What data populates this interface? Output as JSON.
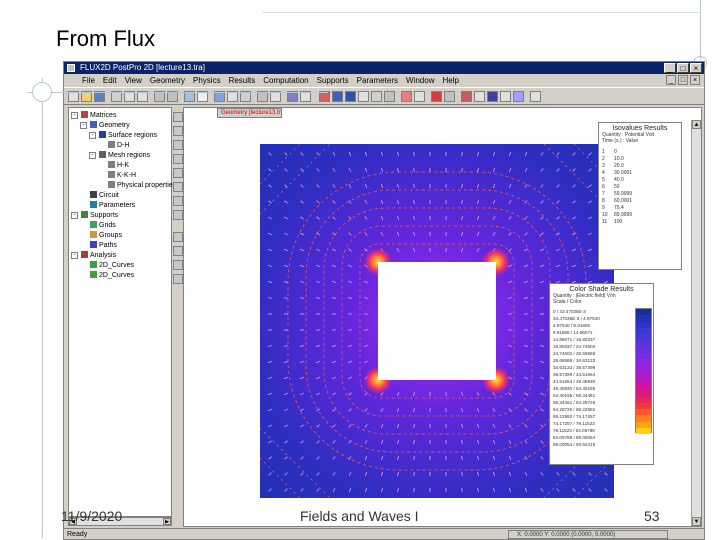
{
  "slide": {
    "title": "From Flux",
    "footer": {
      "date": "11/9/2020",
      "center": "Fields and Waves I",
      "page": "53"
    }
  },
  "window": {
    "title": "FLUX2D  PostPro 2D  [lecture13.tra]",
    "controls": [
      "_",
      "□",
      "×"
    ],
    "menu": [
      "File",
      "Edit",
      "View",
      "Geometry",
      "Physics",
      "Results",
      "Computation",
      "Supports",
      "Parameters",
      "Window",
      "Help"
    ],
    "doc_controls": [
      "_",
      "□",
      "×"
    ],
    "status": {
      "ready": "Ready",
      "coords": "X: 0.0000  Y: 0.0000  (0.0000, 0.0000)"
    }
  },
  "tree": {
    "items": [
      {
        "label": "Matrices",
        "level": 1,
        "expander": "-",
        "icon": "matrix-icon"
      },
      {
        "label": "Geometry",
        "level": 2,
        "expander": "-",
        "icon": "geometry-icon"
      },
      {
        "label": "Surface regions",
        "level": 3,
        "expander": "-",
        "icon": "triangle-icon"
      },
      {
        "label": "D-H",
        "level": 4,
        "expander": "",
        "icon": "beam-icon"
      },
      {
        "label": "Mesh regions",
        "level": 3,
        "expander": "-",
        "icon": "mesh-icon"
      },
      {
        "label": "H-K",
        "level": 4,
        "expander": "",
        "icon": "beam-icon"
      },
      {
        "label": "K-K-H",
        "level": 4,
        "expander": "",
        "icon": "beam-icon"
      },
      {
        "label": "Physical properties",
        "level": 4,
        "expander": "",
        "icon": "beam-icon"
      },
      {
        "label": "Circuit",
        "level": 2,
        "expander": "",
        "icon": "circuit-icon"
      },
      {
        "label": "Parameters",
        "level": 2,
        "expander": "",
        "icon": "parameter-icon"
      },
      {
        "label": "Supports",
        "level": 1,
        "expander": "-",
        "icon": "support-icon"
      },
      {
        "label": "Grids",
        "level": 2,
        "expander": "",
        "icon": "grid-icon"
      },
      {
        "label": "Groups",
        "level": 2,
        "expander": "",
        "icon": "group-icon"
      },
      {
        "label": "Paths",
        "level": 2,
        "expander": "",
        "icon": "path-icon"
      },
      {
        "label": "Analysis",
        "level": 1,
        "expander": "-",
        "icon": "analysis-icon"
      },
      {
        "label": "2D_Curves",
        "level": 2,
        "expander": "",
        "icon": "curve-icon"
      },
      {
        "label": "2D_Curves",
        "level": 2,
        "expander": "",
        "icon": "curve-icon"
      }
    ]
  },
  "document": {
    "tab": "Geometry [lecture13.tra]"
  },
  "isovalue_legend": {
    "title": "Isovalues Results",
    "quantity": "Quantity : Potential Volt",
    "time": "Time (s.) : Value",
    "rows": [
      [
        "1",
        "0"
      ],
      [
        "2",
        "10.0"
      ],
      [
        "3",
        "20.0"
      ],
      [
        "4",
        "30.0001"
      ],
      [
        "5",
        "40.0"
      ],
      [
        "6",
        "50"
      ],
      [
        "7",
        "59.9999"
      ],
      [
        "8",
        "60.0001"
      ],
      [
        "9",
        "79.4"
      ],
      [
        "10",
        "89.9999"
      ],
      [
        "11",
        "100"
      ]
    ]
  },
  "colorshade_legend": {
    "title": "Color Shade Results",
    "quantity": "Quantity : |Electric field| V/m",
    "scale": "Scale / Color",
    "rows": [
      "0  /  33.47035E-3",
      "33.47035E-3  /  4.97540",
      "4.97540  /  9.91806",
      "9.91806  /  14.86071",
      "14.86071  /  19.80337",
      "19.80337  /  24.74602",
      "24.74602  /  29.68868",
      "29.68868  /  34.63133",
      "34.63133  /  39.57399",
      "39.57399  /  44.51664",
      "44.51664  /  49.45930",
      "49.45930  /  54.40195",
      "54.40195  /  59.34461",
      "59.34461  /  64.28726",
      "64.28726  /  69.22992",
      "69.22992  /  74.17257",
      "74.17257  /  79.11523",
      "79.11523  /  84.05788",
      "84.05788  /  89.00054",
      "89.00054  /  93.94319"
    ],
    "colors": [
      "#1a2a9a",
      "#2232b4",
      "#2f34c4",
      "#3d36d0",
      "#4b36d8",
      "#5a34dc",
      "#6a30e0",
      "#7a2ce2",
      "#8a28de",
      "#9a22d6",
      "#aa1ccc",
      "#ba18b8",
      "#cc169c",
      "#dc1a7c",
      "#e8265a",
      "#f23a3a",
      "#f85a2a",
      "#fc7e20",
      "#fea31a",
      "#ffd018"
    ]
  }
}
